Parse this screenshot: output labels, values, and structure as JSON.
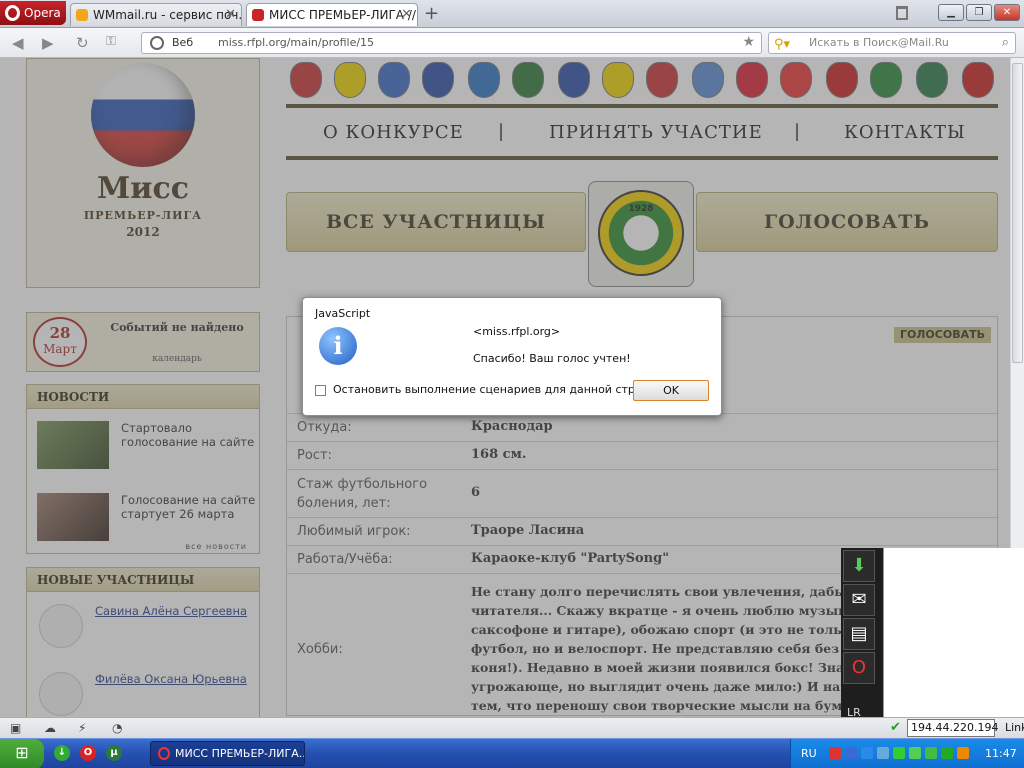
{
  "browser": {
    "menu_label": "Opera",
    "tabs": [
      {
        "title": "WMmail.ru - сервис поч…",
        "active": false
      },
      {
        "title": "МИСС ПРЕМЬЕР-ЛИГА //…",
        "active": true
      }
    ],
    "address": {
      "mode_label": "Веб",
      "url": "miss.rfpl.org/main/profile/15"
    },
    "search_placeholder": "Искать в Поиск@Mail.Ru"
  },
  "site": {
    "logo": {
      "title": "Мисс",
      "subtitle": "ПРЕМЬЕР-ЛИГА",
      "year": "2012"
    },
    "menu": [
      {
        "label": "О КОНКУРСЕ"
      },
      {
        "label": "ПРИНЯТЬ УЧАСТИЕ"
      },
      {
        "label": "КОНТАКТЫ"
      }
    ],
    "all_participants_button": "ВСЕ УЧАСТНИЦЫ",
    "vote_button": "ГОЛОСОВАТЬ",
    "club_emblem_year": "1928",
    "calendar": {
      "day": "28",
      "month": "Март",
      "message": "Событий не найдено",
      "link": "календарь"
    },
    "news": {
      "heading": "НОВОСТИ",
      "items": [
        {
          "text": "Стартовало голосование на сайте"
        },
        {
          "text": "Голосование на сайте стартует 26 марта"
        }
      ],
      "all_link": "все новости"
    },
    "new_participants": {
      "heading": "НОВЫЕ УЧАСТНИЦЫ",
      "items": [
        {
          "name": "Савина Алёна Сергеевна"
        },
        {
          "name": "Филёва Оксана Юрьевна"
        }
      ]
    },
    "profile": {
      "vote_small": "ГОЛОСОВАТЬ",
      "rows": [
        {
          "label": "Откуда:",
          "value": "Краснодар"
        },
        {
          "label": "Рост:",
          "value": "168 см."
        },
        {
          "label": "Стаж футбольного боления, лет:",
          "value": "6"
        },
        {
          "label": "Любимый игрок:",
          "value": "Траоре Ласина"
        },
        {
          "label": "Работа/Учёба:",
          "value": "Караоке-клуб \"PartySong\""
        }
      ],
      "hobby_label": "Хобби:",
      "hobby_text": "Не стану долго перечислять свои увлечения, дабы не утомить читателя... Скажу вкратце - я очень люблю музыку (играю на саксофоне и гитаре), обожаю спорт (и это не только мой любимый футбол, но и велоспорт. Не представляю себя без моего железного коня!). Недавно в моей жизни появился бокс! Знаю, что звучит угрожающе, но выглядит очень даже мило:) И наконец, занимаюсь тем, что переношу свои творческие мысли на бумагу - пишу книгу о соблазнении."
    }
  },
  "dialog": {
    "title": "JavaScript",
    "origin": "<miss.rfpl.org>",
    "message": "Спасибо! Ваш голос учтен!",
    "checkbox_label": "Остановить выполнение сценариев для данной страницы",
    "ok_label": "OK"
  },
  "side_panel": {
    "label": "LR"
  },
  "status_bar": {
    "ip": "194.44.220.194",
    "link_label": "Link"
  },
  "taskbar": {
    "task_label": "МИСС ПРЕМЬЕР-ЛИГА...",
    "language": "RU",
    "clock": "11:47"
  },
  "colors": {
    "accent_gold": "#d8cc96",
    "dark_olive": "#5a5236",
    "opera_red": "#c8242a",
    "calendar_red": "#b12d23",
    "taskbar_blue": "#2550b0"
  },
  "icons": [
    "opera-logo-icon",
    "new-tab-icon",
    "trash-icon",
    "back-icon",
    "forward-icon",
    "reload-icon",
    "key-icon",
    "globe-icon",
    "star-icon",
    "search-engine-icon",
    "magnifier-icon",
    "info-icon",
    "download-icon",
    "mail-icon",
    "notes-icon",
    "opera-icon",
    "checkmark-icon",
    "windows-logo-icon"
  ]
}
